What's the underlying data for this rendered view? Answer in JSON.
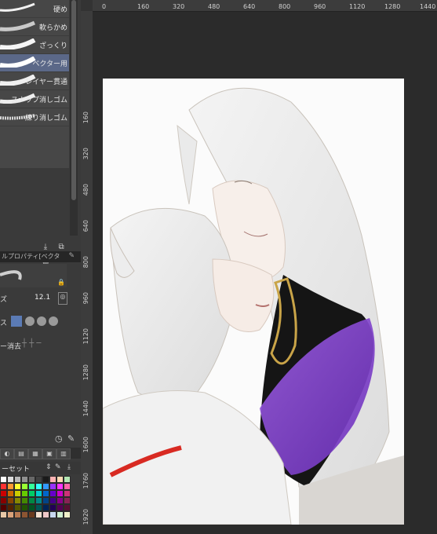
{
  "brushes": {
    "items": [
      {
        "label": "硬め"
      },
      {
        "label": "軟らかめ"
      },
      {
        "label": "ざっくり"
      },
      {
        "label": "ベクター用",
        "selected": true
      },
      {
        "label": "レイヤー貫通"
      },
      {
        "label": "スナップ消しゴム"
      },
      {
        "label": "練り消しゴム"
      }
    ]
  },
  "tool_property": {
    "title": "ルプロパティ[ベクタ",
    "size_label": "ズ",
    "size_value": "12.1",
    "opacity_label": "ス",
    "erase_label": "ー消去"
  },
  "color_set": {
    "label": "ーセット"
  },
  "ruler_top": {
    "ticks": [
      "0",
      "160",
      "320",
      "480",
      "640",
      "800",
      "960",
      "1120",
      "1280",
      "1440"
    ]
  },
  "ruler_left": {
    "ticks": [
      "160",
      "320",
      "480",
      "640",
      "800",
      "960",
      "1120",
      "1280",
      "1440",
      "1600",
      "1760",
      "1920"
    ]
  },
  "colors": {
    "accent_selected": "#5b6888",
    "panel_bg": "#3a3a3a",
    "canvas_bg": "#fbfbfb",
    "scarf": "#7b3fc6"
  }
}
